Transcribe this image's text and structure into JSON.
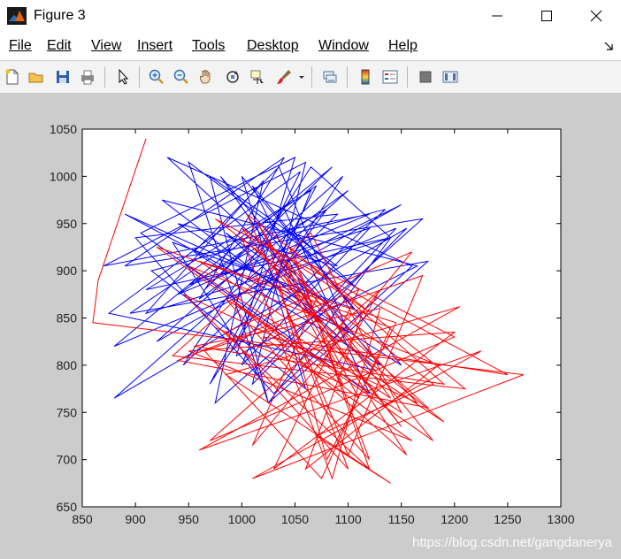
{
  "window": {
    "title": "Figure 3",
    "controls": [
      "minimize",
      "maximize",
      "close"
    ]
  },
  "menu": {
    "items": [
      "File",
      "Edit",
      "View",
      "Insert",
      "Tools",
      "Desktop",
      "Window",
      "Help"
    ]
  },
  "toolbar": {
    "icons": [
      "new-figure-icon",
      "open-file-icon",
      "save-icon",
      "print-icon",
      "pointer-icon",
      "zoom-in-icon",
      "zoom-out-icon",
      "pan-hand-icon",
      "rotate-3d-icon",
      "data-cursor-icon",
      "brush-icon",
      "brush-dropdown-icon",
      "link-plot-icon",
      "insert-colorbar-icon",
      "insert-legend-icon",
      "hide-plot-tools-icon",
      "show-plot-tools-icon"
    ]
  },
  "chart_data": {
    "type": "line",
    "title": "",
    "xlabel": "",
    "ylabel": "",
    "xlim": [
      850,
      1300
    ],
    "ylim": [
      650,
      1050
    ],
    "xticks": [
      850,
      900,
      950,
      1000,
      1050,
      1100,
      1150,
      1200,
      1250,
      1300
    ],
    "yticks": [
      650,
      700,
      750,
      800,
      850,
      900,
      950,
      1000,
      1050
    ],
    "grid": false,
    "series": [
      {
        "color": "#0000ff",
        "x": [
          1000,
          940,
          1120,
          870,
          1060,
          1010,
          1155,
          880,
          1100,
          960,
          1040,
          890,
          1170,
          975,
          1020,
          910,
          1140,
          1065,
          945,
          1090,
          900,
          1030,
          1160,
          930,
          1080,
          985,
          1125,
          875,
          1055,
          1005,
          1150,
          920,
          1095,
          970,
          1045,
          1110,
          950,
          1025,
          1175,
          895,
          1070,
          990,
          1135,
          915,
          1060,
          1000,
          1105,
          935,
          1015,
          1145,
          880,
          1085,
          965,
          1040,
          1120,
          905,
          1050,
          995,
          1165,
          925,
          1075,
          980,
          1130,
          955,
          1035,
          1100,
          890,
          1060,
          1010,
          1150,
          940,
          1090,
          970,
          1025,
          1140,
          910,
          1065,
          1000,
          1120,
          950,
          1080,
          1040
        ],
        "y": [
          920,
          875,
          960,
          905,
          1015,
          780,
          945,
          765,
          985,
          870,
          1020,
          905,
          955,
          760,
          995,
          855,
          935,
          1010,
          800,
          960,
          935,
          770,
          905,
          1020,
          865,
          940,
          795,
          855,
          1005,
          890,
          970,
          825,
          1000,
          780,
          945,
          880,
          1015,
          760,
          910,
          855,
          990,
          815,
          965,
          900,
          775,
          1000,
          860,
          930,
          790,
          945,
          820,
          1010,
          880,
          965,
          770,
          940,
          1020,
          810,
          905,
          975,
          845,
          1000,
          800,
          920,
          1010,
          835,
          960,
          875,
          990,
          800,
          950,
          905,
          1000,
          760,
          935,
          880,
          985,
          800,
          945,
          885,
          965,
          905
        ]
      },
      {
        "color": "#ff0000",
        "x": [
          910,
          865,
          860,
          1265,
          1010,
          1225,
          960,
          1205,
          985,
          1140,
          1070,
          1180,
          975,
          1250,
          1020,
          1160,
          950,
          1200,
          1030,
          1110,
          940,
          1175,
          1000,
          1085,
          1130,
          955,
          1190,
          1045,
          1120,
          985,
          1150,
          1065,
          935,
          1210,
          1005,
          1100,
          1170,
          965,
          1075,
          1140,
          920,
          1180,
          1040,
          1110,
          990,
          1155,
          1015,
          1090,
          1130,
          970,
          1200,
          1050,
          1120,
          945,
          1165,
          1025,
          1080,
          1145,
          960,
          1190,
          1035,
          1100,
          985,
          1160,
          1010,
          1070,
          1140,
          950,
          1185,
          1060,
          1115,
          1000,
          1150,
          1040,
          1095,
          975
        ],
        "y": [
          1040,
          890,
          845,
          790,
          680,
          815,
          710,
          862,
          790,
          675,
          725,
          780,
          955,
          790,
          830,
          720,
          815,
          835,
          690,
          880,
          805,
          755,
          935,
          680,
          860,
          820,
          780,
          925,
          700,
          870,
          750,
          940,
          810,
          775,
          960,
          705,
          895,
          815,
          680,
          840,
          925,
          720,
          910,
          765,
          870,
          705,
          950,
          800,
          880,
          720,
          830,
          915,
          690,
          875,
          760,
          930,
          700,
          845,
          910,
          740,
          880,
          690,
          835,
          920,
          715,
          870,
          765,
          905,
          800,
          690,
          860,
          945,
          735,
          895,
          780,
          840
        ]
      }
    ]
  },
  "watermark": "https://blog.csdn.net/gangdanerya"
}
